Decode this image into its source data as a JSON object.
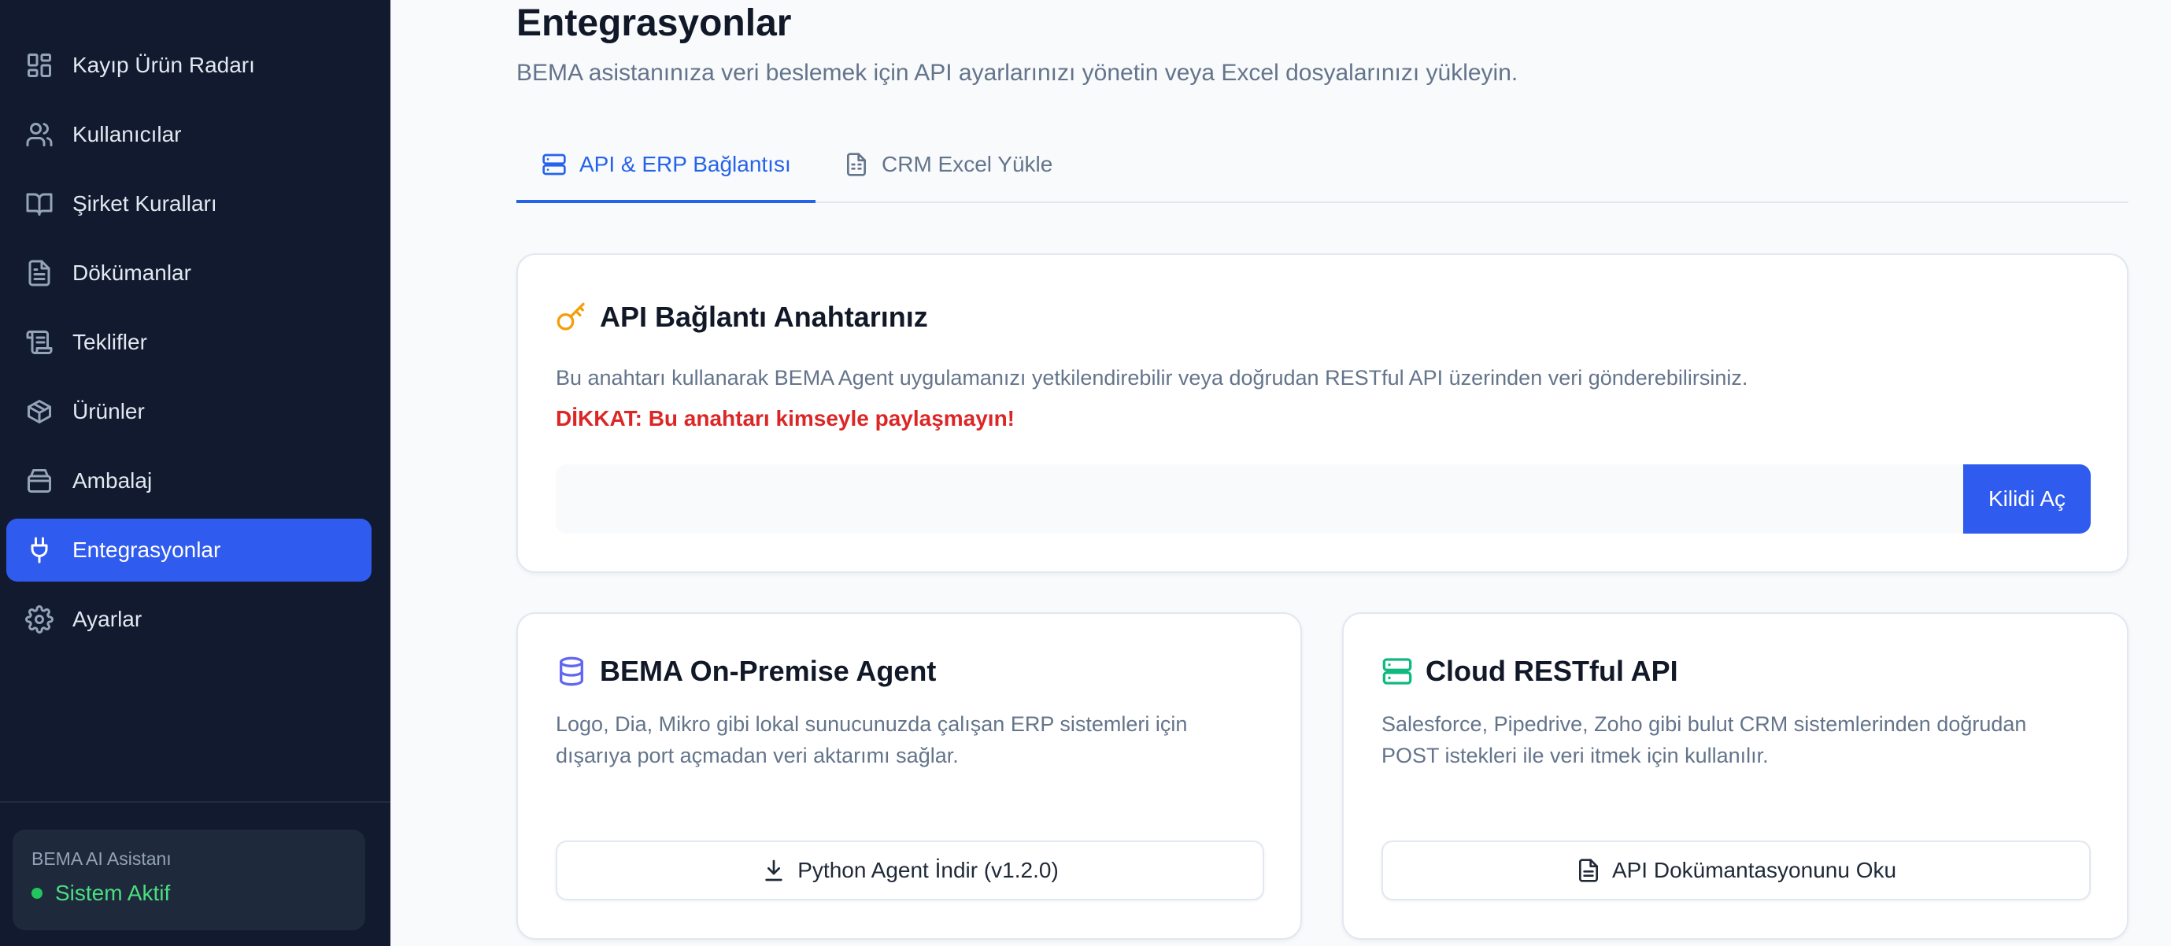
{
  "sidebar": {
    "items": [
      {
        "label": "Kayıp Ürün Radarı",
        "icon": "grid-icon"
      },
      {
        "label": "Kullanıcılar",
        "icon": "users-icon"
      },
      {
        "label": "Şirket Kuralları",
        "icon": "book-icon"
      },
      {
        "label": "Dökümanlar",
        "icon": "document-icon"
      },
      {
        "label": "Teklifler",
        "icon": "scroll-icon"
      },
      {
        "label": "Ürünler",
        "icon": "box-icon"
      },
      {
        "label": "Ambalaj",
        "icon": "package-icon"
      },
      {
        "label": "Entegrasyonlar",
        "icon": "plug-icon",
        "active": true
      },
      {
        "label": "Ayarlar",
        "icon": "gear-icon"
      }
    ],
    "status": {
      "title": "BEMA AI Asistanı",
      "text": "Sistem Aktif",
      "color": "#22c55e"
    }
  },
  "page": {
    "title": "Entegrasyonlar",
    "subtitle": "BEMA asistanınıza veri beslemek için API ayarlarınızı yönetin veya Excel dosyalarınızı yükleyin."
  },
  "tabs": [
    {
      "label": "API & ERP Bağlantısı",
      "icon": "server-icon",
      "active": true
    },
    {
      "label": "CRM Excel Yükle",
      "icon": "spreadsheet-icon",
      "active": false
    }
  ],
  "api_key_card": {
    "title": "API Bağlantı Anahtarınız",
    "icon": "key-icon",
    "description": "Bu anahtarı kullanarak BEMA Agent uygulamanızı yetkilendirebilir veya doğrudan RESTful API üzerinden veri gönderebilirsiniz.",
    "warning": "DİKKAT: Bu anahtarı kimseyle paylaşmayın!",
    "input_value": "",
    "unlock_label": "Kilidi Aç"
  },
  "agent_card": {
    "title": "BEMA On-Premise Agent",
    "icon": "database-icon",
    "description": "Logo, Dia, Mikro gibi lokal sunucunuzda çalışan ERP sistemleri için dışarıya port açmadan veri aktarımı sağlar.",
    "button_label": "Python Agent İndir (v1.2.0)",
    "button_icon": "download-icon"
  },
  "api_card": {
    "title": "Cloud RESTful API",
    "icon": "server-icon",
    "description": "Salesforce, Pipedrive, Zoho gibi bulut CRM sistemlerinden doğrudan POST istekleri ile veri itmek için kullanılır.",
    "button_label": "API Dokümantasyonunu Oku",
    "button_icon": "document-icon"
  },
  "colors": {
    "sidebar_bg": "#111a2e",
    "accent": "#2f5bef",
    "warning": "#dc2626",
    "key_icon": "#f59e0b",
    "database_icon": "#6366f1",
    "server_icon": "#10b981"
  }
}
